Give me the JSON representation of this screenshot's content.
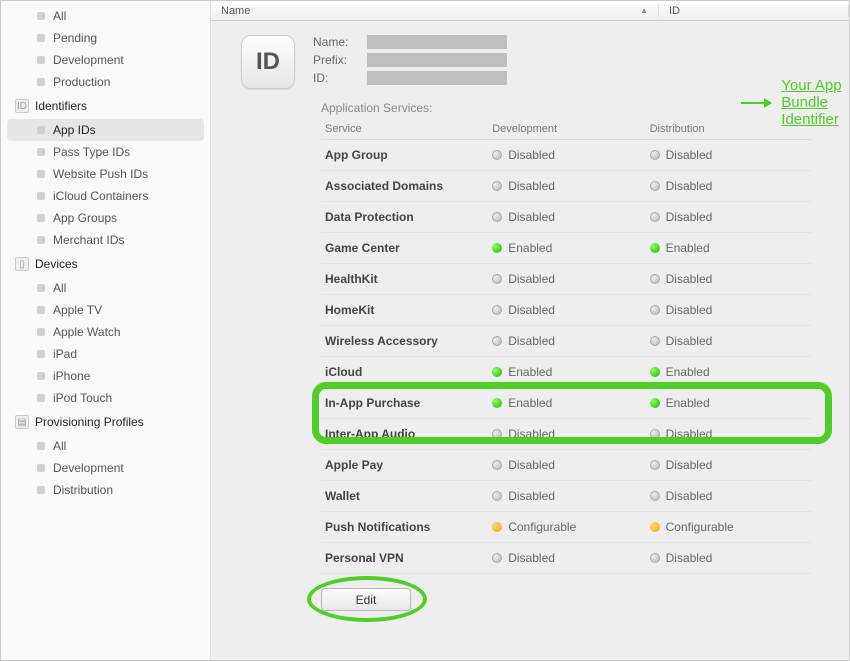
{
  "sidebar": {
    "certificates_items": [
      {
        "label": "All"
      },
      {
        "label": "Pending"
      },
      {
        "label": "Development"
      },
      {
        "label": "Production"
      }
    ],
    "identifiers_header": "Identifiers",
    "identifiers_icon_text": "ID",
    "identifiers_items": [
      {
        "label": "App IDs",
        "selected": true
      },
      {
        "label": "Pass Type IDs"
      },
      {
        "label": "Website Push IDs"
      },
      {
        "label": "iCloud Containers"
      },
      {
        "label": "App Groups"
      },
      {
        "label": "Merchant IDs"
      }
    ],
    "devices_header": "Devices",
    "devices_items": [
      {
        "label": "All"
      },
      {
        "label": "Apple TV"
      },
      {
        "label": "Apple Watch"
      },
      {
        "label": "iPad"
      },
      {
        "label": "iPhone"
      },
      {
        "label": "iPod Touch"
      }
    ],
    "profiles_header": "Provisioning Profiles",
    "profiles_items": [
      {
        "label": "All"
      },
      {
        "label": "Development"
      },
      {
        "label": "Distribution"
      }
    ]
  },
  "columns": {
    "name": "Name",
    "id": "ID"
  },
  "detail": {
    "badge_text": "ID",
    "name_label": "Name:",
    "prefix_label": "Prefix:",
    "id_label": "ID:",
    "annotation": "Your App Bundle Identifier",
    "services_title": "Application Services:",
    "head_service": "Service",
    "head_dev": "Development",
    "head_dist": "Distribution",
    "edit_label": "Edit"
  },
  "status": {
    "disabled": "Disabled",
    "enabled": "Enabled",
    "configurable": "Configurable"
  },
  "services": [
    {
      "name": "App Group",
      "dev": "disabled",
      "dist": "disabled"
    },
    {
      "name": "Associated Domains",
      "dev": "disabled",
      "dist": "disabled"
    },
    {
      "name": "Data Protection",
      "dev": "disabled",
      "dist": "disabled"
    },
    {
      "name": "Game Center",
      "dev": "enabled",
      "dist": "enabled"
    },
    {
      "name": "HealthKit",
      "dev": "disabled",
      "dist": "disabled"
    },
    {
      "name": "HomeKit",
      "dev": "disabled",
      "dist": "disabled"
    },
    {
      "name": "Wireless Accessory",
      "dev": "disabled",
      "dist": "disabled"
    },
    {
      "name": "iCloud",
      "dev": "enabled",
      "dist": "enabled",
      "highlighted": true
    },
    {
      "name": "In-App Purchase",
      "dev": "enabled",
      "dist": "enabled"
    },
    {
      "name": "Inter-App Audio",
      "dev": "disabled",
      "dist": "disabled"
    },
    {
      "name": "Apple Pay",
      "dev": "disabled",
      "dist": "disabled"
    },
    {
      "name": "Wallet",
      "dev": "disabled",
      "dist": "disabled"
    },
    {
      "name": "Push Notifications",
      "dev": "configurable",
      "dist": "configurable"
    },
    {
      "name": "Personal VPN",
      "dev": "disabled",
      "dist": "disabled"
    }
  ]
}
